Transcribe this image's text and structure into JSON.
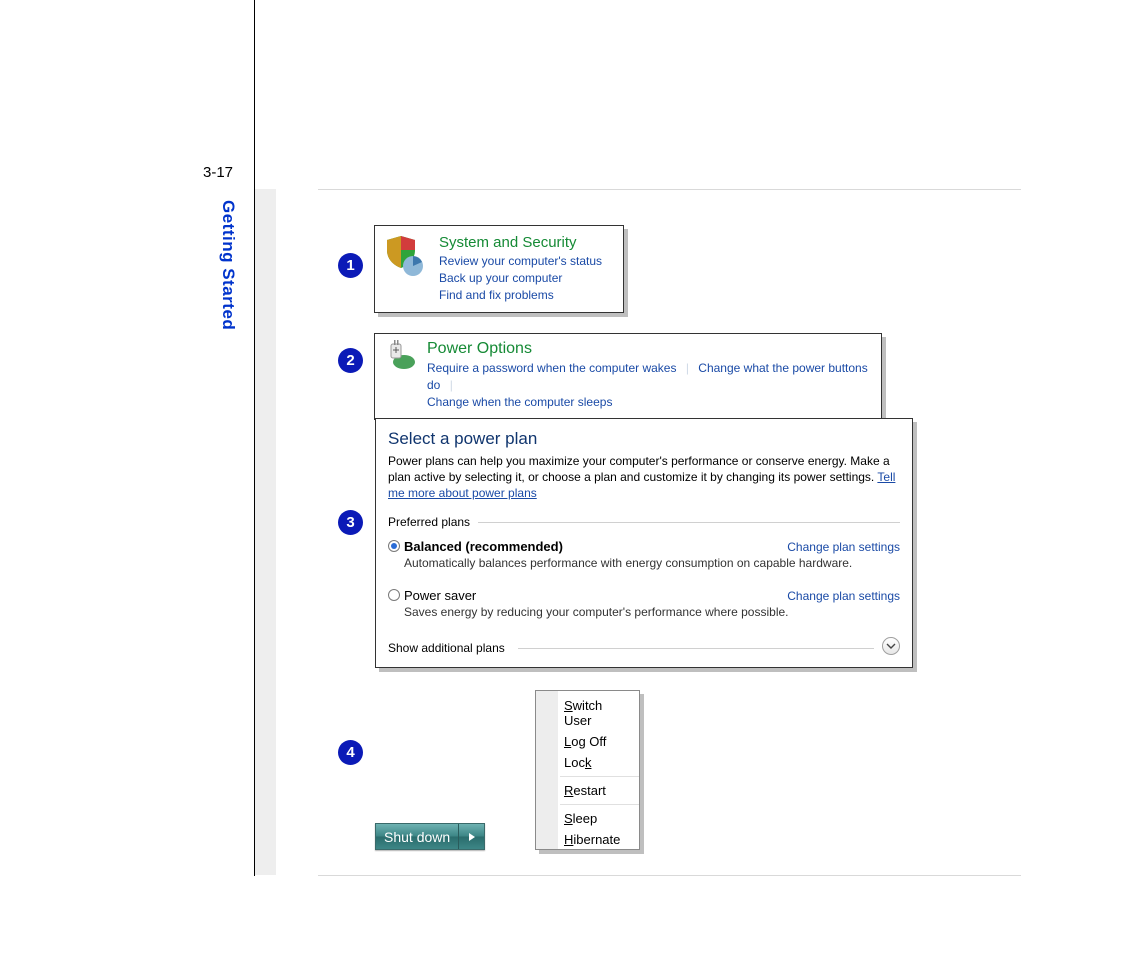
{
  "page_number": "3-17",
  "side_label": "Getting Started",
  "callouts": {
    "c1": "1",
    "c2": "2",
    "c3": "3",
    "c4": "4"
  },
  "panel1": {
    "title": "System and Security",
    "links": {
      "l1": "Review your computer's status",
      "l2": "Back up your computer",
      "l3": "Find and fix problems"
    }
  },
  "panel2": {
    "title": "Power Options",
    "links": {
      "l1": "Require a password when the computer wakes",
      "l2": "Change what the power buttons do",
      "l3": "Change when the computer sleeps"
    }
  },
  "panel3": {
    "heading": "Select a power plan",
    "desc": "Power plans can help you maximize your computer's performance or conserve energy. Make a plan active by selecting it, or choose a plan and customize it by changing its power settings. ",
    "more": "Tell me more about power plans",
    "group": "Preferred plans",
    "plan1": {
      "name": "Balanced (recommended)",
      "sub": "Automatically balances performance with energy consumption on capable hardware.",
      "change": "Change plan settings"
    },
    "plan2": {
      "name": "Power saver",
      "sub": "Saves energy by reducing your computer's performance where possible.",
      "change": "Change plan settings"
    },
    "show": "Show additional plans"
  },
  "panel4": {
    "shutdown": "Shut down",
    "menu": {
      "switch_user_pre": "S",
      "switch_user": "witch User",
      "logoff_pre": "L",
      "logoff": "og Off",
      "lock_pre": "L",
      "lock": "oc",
      "lock_post": "k",
      "lock_k": "k",
      "lock_full_pre": "Loc",
      "lock_full_u": "k",
      "restart_pre": "R",
      "restart": "estart",
      "sleep_pre": "S",
      "sleep": "leep",
      "hibernate_pre": "H",
      "hibernate": "ibernate",
      "lock_label_pre": "Loc",
      "lock_label_u": "k"
    }
  }
}
